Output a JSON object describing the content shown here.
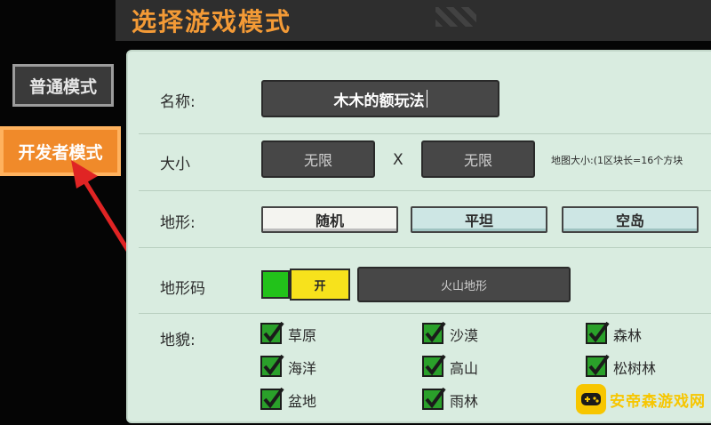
{
  "header": {
    "title": "选择游戏模式"
  },
  "sidebar": {
    "items": [
      {
        "label": "普通模式",
        "selected": false
      },
      {
        "label": "开发者模式",
        "selected": true
      }
    ]
  },
  "form": {
    "name": {
      "label": "名称:",
      "value": "木木的额玩法"
    },
    "size": {
      "label": "大小",
      "width_value": "无限",
      "height_value": "无限",
      "separator": "X",
      "hint": "地图大小:(1区块长=16个方块"
    },
    "terrain": {
      "label": "地形:",
      "options": [
        "随机",
        "平坦",
        "空岛"
      ],
      "selected": "随机"
    },
    "terrain_code": {
      "label": "地形码",
      "toggle_label": "开",
      "value": "火山地形"
    },
    "landforms": {
      "label": "地貌:",
      "items": [
        "草原",
        "沙漠",
        "森林",
        "海洋",
        "高山",
        "松树林",
        "盆地",
        "雨林"
      ]
    }
  },
  "watermark": {
    "text": "安帝森游戏网"
  },
  "colors": {
    "accent": "#f08a2a",
    "title": "#f39a36",
    "panel": "#d9ece0",
    "check": "#2aa02a"
  },
  "icons": [
    "checkmark-icon",
    "arrow-icon",
    "gamepad-icon"
  ]
}
